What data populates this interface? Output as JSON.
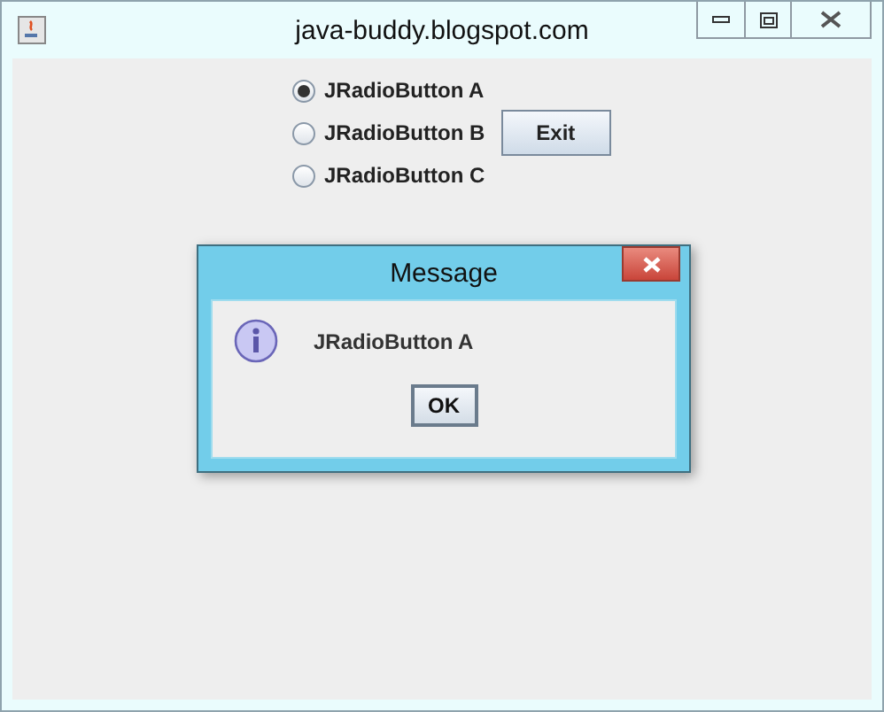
{
  "window": {
    "title": "java-buddy.blogspot.com"
  },
  "radios": [
    {
      "label": "JRadioButton A",
      "selected": true
    },
    {
      "label": "JRadioButton B",
      "selected": false
    },
    {
      "label": "JRadioButton C",
      "selected": false
    }
  ],
  "exit_button": {
    "label": "Exit"
  },
  "dialog": {
    "title": "Message",
    "message": "JRadioButton A",
    "button": "OK"
  }
}
